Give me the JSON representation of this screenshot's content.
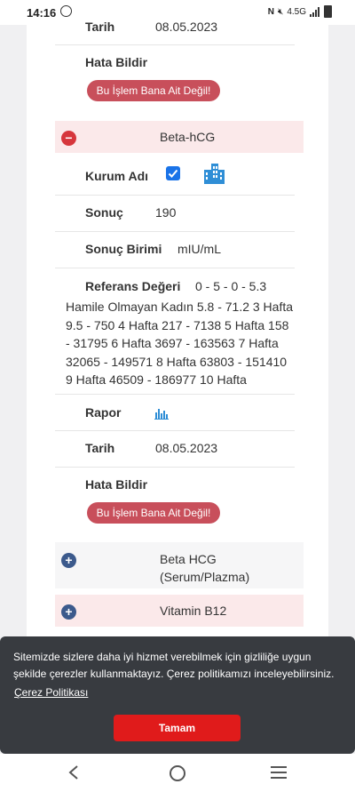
{
  "status_bar": {
    "time": "14:16",
    "network": "4.5G"
  },
  "top_item": {
    "date_label": "Tarih",
    "date_value": "08.05.2023",
    "report_error_label": "Hata Bildir",
    "not_mine_button": "Bu İşlem Bana Ait Değil!"
  },
  "expanded_test": {
    "title": "Beta-hCG",
    "institution_label": "Kurum Adı",
    "result_label": "Sonuç",
    "result_value": "190",
    "unit_label": "Sonuç Birimi",
    "unit_value": "mIU/mL",
    "reference_label": "Referans Değeri",
    "reference_value_first": "0 - 5 - 0 - 5.3",
    "reference_lines": [
      "Hamile Olmayan Kadın 5.8 - 71.2 3 Hafta",
      "9.5 - 750 4 Hafta 217 - 7138 5 Hafta 158",
      "- 31795 6 Hafta 3697 - 163563 7 Hafta",
      "32065 - 149571 8 Hafta 63803 - 151410",
      "9 Hafta 46509 - 186977 10 Hafta"
    ],
    "report_label": "Rapor",
    "date_label": "Tarih",
    "date_value": "08.05.2023",
    "report_error_label": "Hata Bildir",
    "not_mine_button": "Bu İşlem Bana Ait Değil!"
  },
  "collapsed_tests": [
    {
      "title_line1": "Beta HCG",
      "title_line2": "(Serum/Plazma)"
    },
    {
      "title_line1": "Vitamin B12",
      "title_line2": ""
    }
  ],
  "cookie_banner": {
    "text_line1": "Sitemizde sizlere daha iyi hizmet verebilmek için gizliliğe uygun",
    "text_line2": "şekilde çerezler kullanmaktayız. Çerez politikamızı inceleyebilirsiniz.",
    "policy_link": "Çerez Politikası",
    "ok_button": "Tamam"
  },
  "colors": {
    "accent_red": "#c84f5b",
    "pink_row": "#fbe9ea",
    "checkbox_blue": "#1a73e8",
    "icon_blue": "#2f8ed6",
    "cookie_bg": "#383b40",
    "cookie_button": "#e01b1b"
  },
  "icons": {
    "building": "building-icon",
    "chart": "bar-chart-icon",
    "back": "back-icon",
    "home": "home-icon",
    "recents": "recents-icon"
  }
}
